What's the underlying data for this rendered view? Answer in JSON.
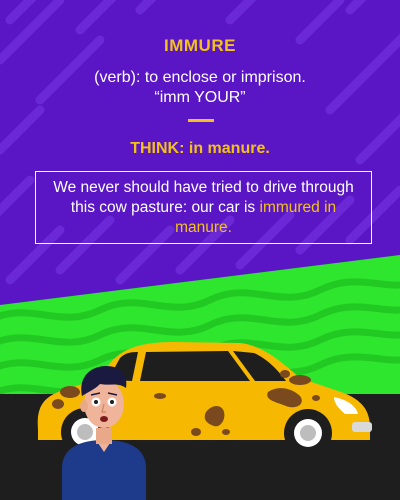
{
  "card": {
    "word": "IMMURE",
    "definition_line1": "(verb): to enclose or imprison.",
    "definition_line2": "“imm YOUR”",
    "think": "THINK: in manure.",
    "example_part1": "We never should have tried to drive through this cow pasture: our car is",
    "example_highlight": "immured in manure."
  },
  "colors": {
    "background": "#5a16c4",
    "accent": "#f3c21a",
    "grass": "#2ee62e",
    "car": "#f6b800",
    "road": "#1e1e1e"
  }
}
